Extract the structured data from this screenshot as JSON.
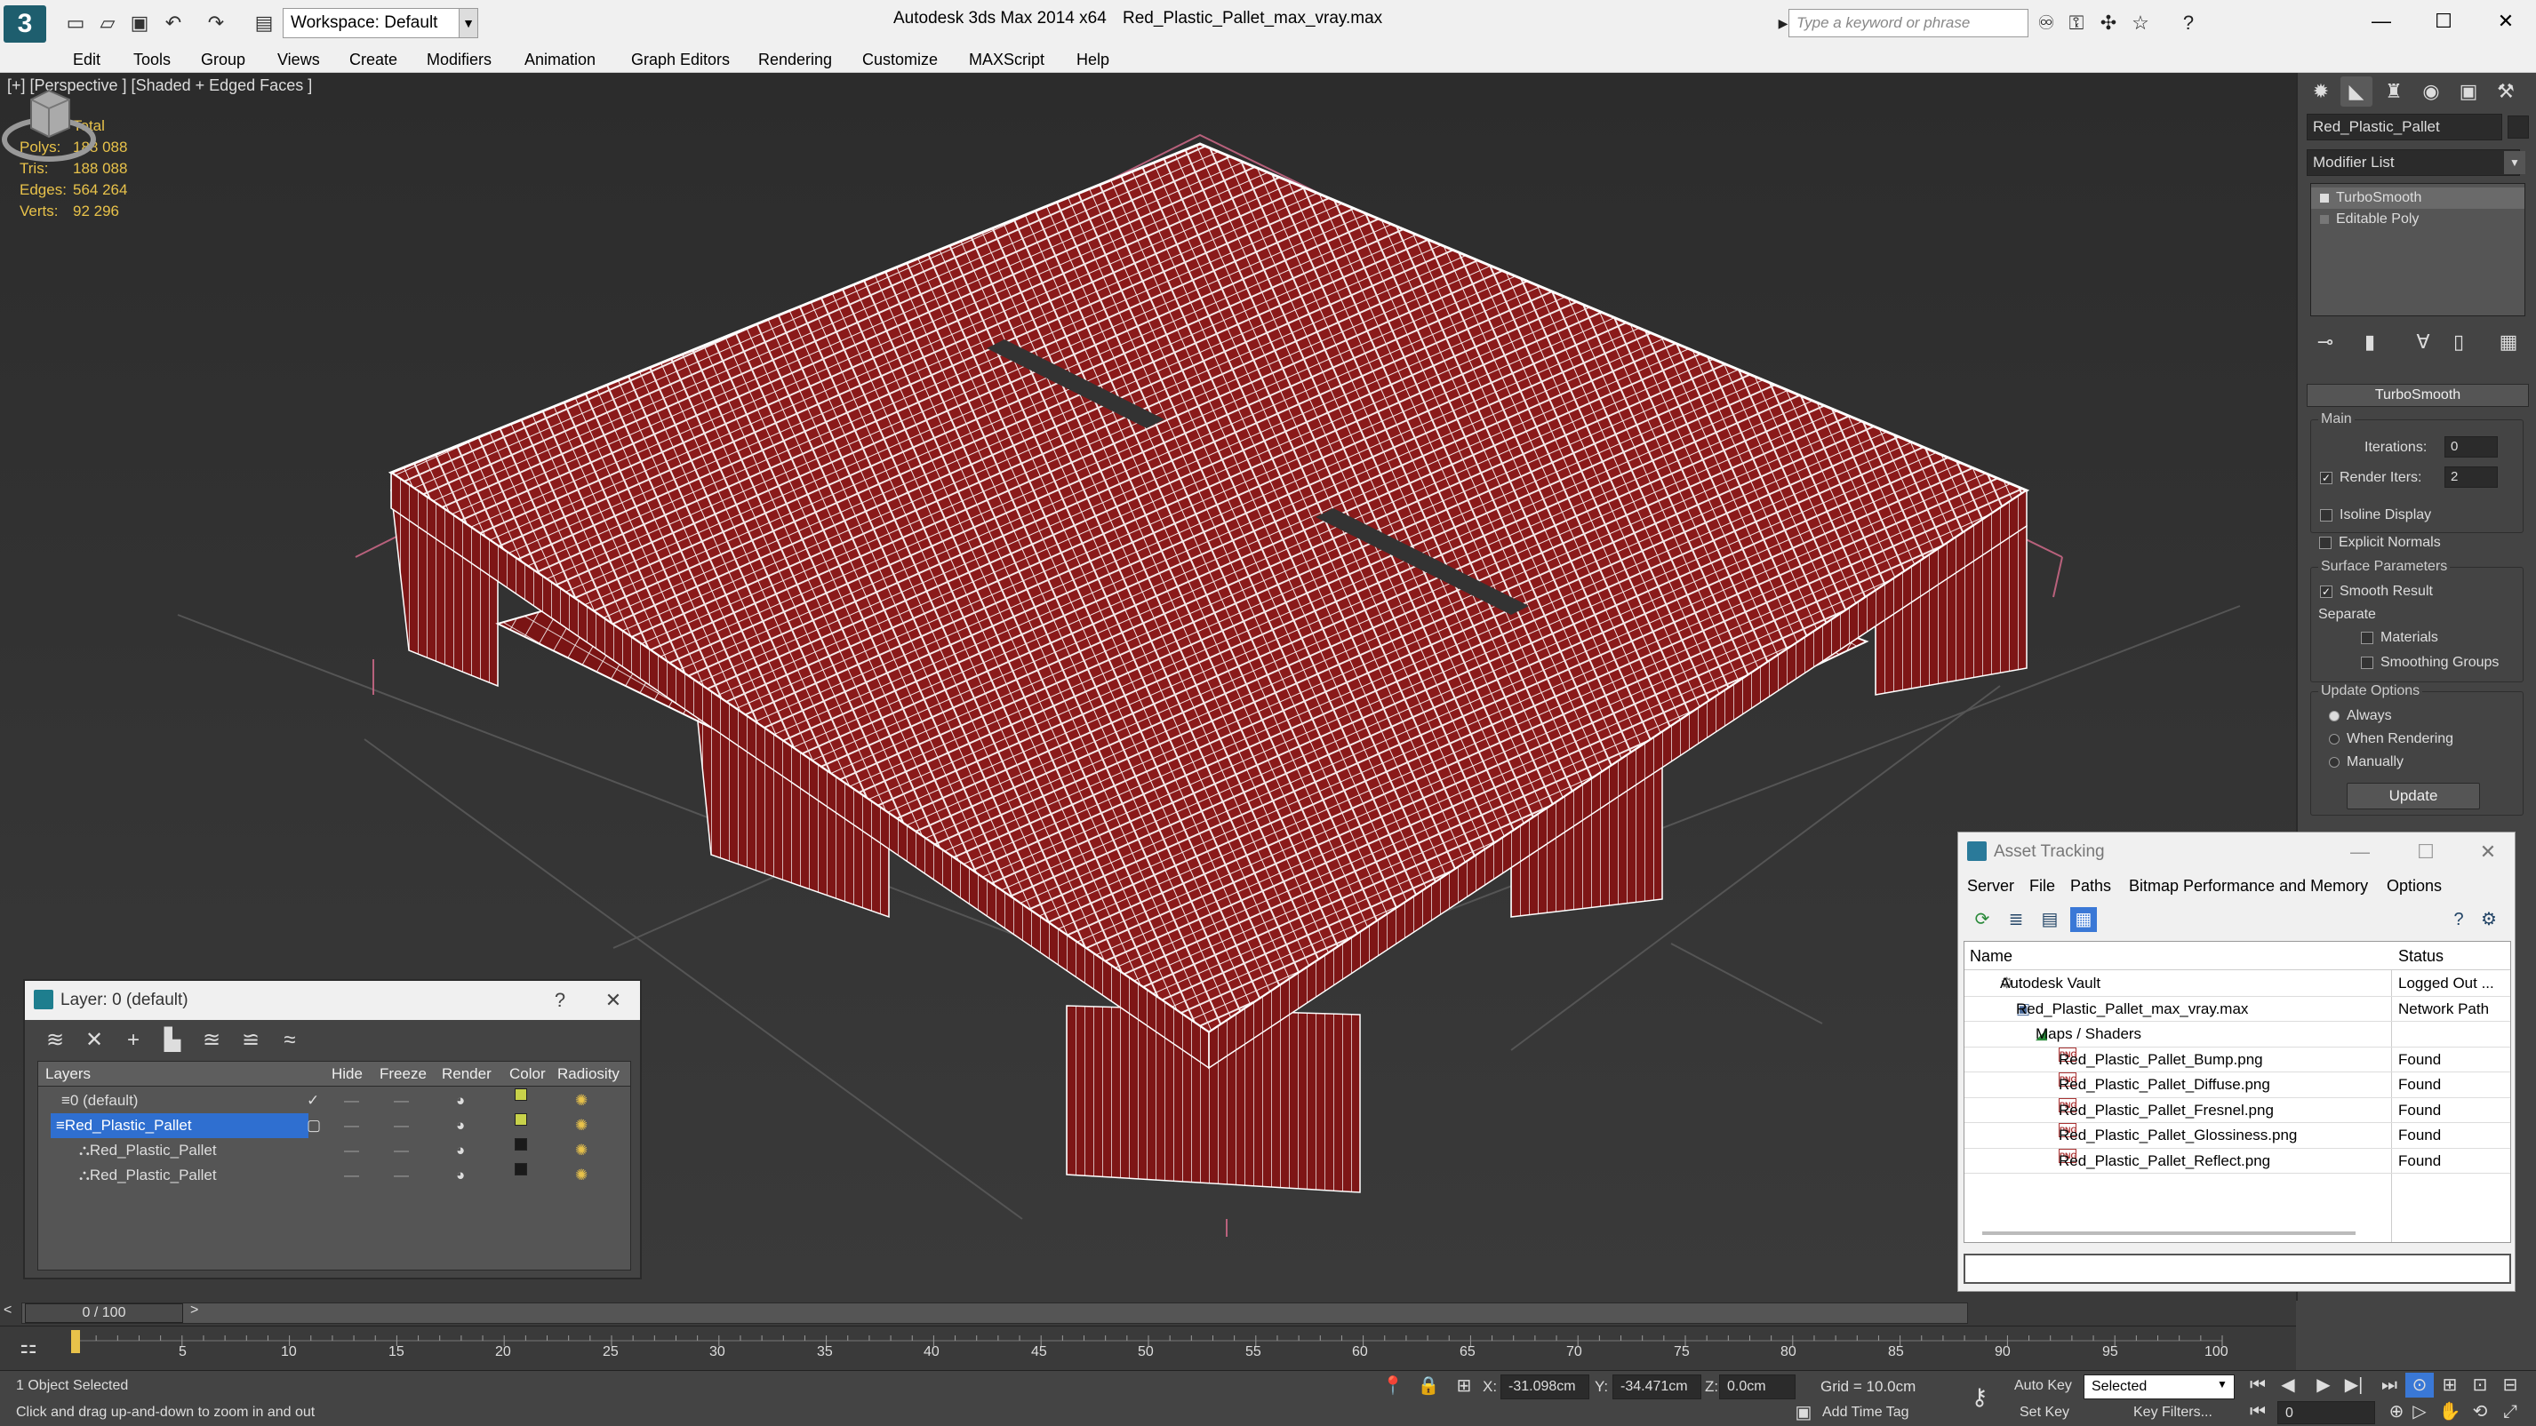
{
  "app": {
    "title": "Autodesk 3ds Max  2014 x64",
    "file": "Red_Plastic_Pallet_max_vray.max",
    "workspace": "Workspace: Default",
    "search_placeholder": "Type a keyword or phrase"
  },
  "menu": [
    "Edit",
    "Tools",
    "Group",
    "Views",
    "Create",
    "Modifiers",
    "Animation",
    "Graph Editors",
    "Rendering",
    "Customize",
    "MAXScript",
    "Help"
  ],
  "viewport": {
    "label": "[+] [Perspective ] [Shaded + Edged Faces ]",
    "stats": {
      "header": "Total",
      "rows": [
        {
          "label": "Polys:",
          "value": "188 088"
        },
        {
          "label": "Tris:",
          "value": "188 088"
        },
        {
          "label": "Edges:",
          "value": "564 264"
        },
        {
          "label": "Verts:",
          "value": "92 296"
        }
      ]
    }
  },
  "command_panel": {
    "object_name": "Red_Plastic_Pallet",
    "modifier_list": "Modifier List",
    "stack": [
      "TurboSmooth",
      "Editable Poly"
    ],
    "rollout_title": "TurboSmooth",
    "main_group": "Main",
    "iterations_label": "Iterations:",
    "iterations_value": "0",
    "render_iters_label": "Render Iters:",
    "render_iters_value": "2",
    "isoline": "Isoline Display",
    "explicit_normals": "Explicit Normals",
    "surface_group": "Surface Parameters",
    "smooth_result": "Smooth Result",
    "separate": "Separate",
    "materials": "Materials",
    "smoothing_groups": "Smoothing Groups",
    "update_group": "Update Options",
    "always": "Always",
    "when_rendering": "When Rendering",
    "manually": "Manually",
    "update_button": "Update"
  },
  "layer_window": {
    "title": "Layer: 0 (default)",
    "help": "?",
    "columns": [
      "Layers",
      "Hide",
      "Freeze",
      "Render",
      "Color",
      "Radiosity"
    ],
    "rows": [
      {
        "name": "0 (default)",
        "color": "#c8d24a"
      },
      {
        "name": "Red_Plastic_Pallet",
        "color": "#c8d24a"
      },
      {
        "name": "Red_Plastic_Pallet",
        "color": "#1a1a1a"
      },
      {
        "name": "Red_Plastic_Pallet",
        "color": "#1a1a1a"
      }
    ]
  },
  "asset_tracking": {
    "title": "Asset Tracking",
    "menu": [
      "Server",
      "File",
      "Paths",
      "Bitmap Performance and Memory",
      "Options"
    ],
    "columns": [
      "Name",
      "Status"
    ],
    "rows": [
      {
        "name": "Autodesk Vault",
        "status": "Logged Out ..."
      },
      {
        "name": "Red_Plastic_Pallet_max_vray.max",
        "status": "Network Path"
      },
      {
        "name": "Maps / Shaders",
        "status": ""
      },
      {
        "name": "Red_Plastic_Pallet_Bump.png",
        "status": "Found"
      },
      {
        "name": "Red_Plastic_Pallet_Diffuse.png",
        "status": "Found"
      },
      {
        "name": "Red_Plastic_Pallet_Fresnel.png",
        "status": "Found"
      },
      {
        "name": "Red_Plastic_Pallet_Glossiness.png",
        "status": "Found"
      },
      {
        "name": "Red_Plastic_Pallet_Reflect.png",
        "status": "Found"
      }
    ],
    "png_badge": "PNG"
  },
  "timeline": {
    "slider": "0 / 100",
    "ticks": [
      "5",
      "10",
      "15",
      "20",
      "25",
      "30",
      "35",
      "40",
      "45",
      "50",
      "55",
      "60",
      "65",
      "70",
      "75",
      "80",
      "85",
      "90",
      "95",
      "100"
    ]
  },
  "status": {
    "selection": "1 Object Selected",
    "prompt": "Click and drag up-and-down to zoom in and out",
    "x_label": "X:",
    "x_value": "-31.098cm",
    "y_label": "Y:",
    "y_value": "-34.471cm",
    "z_label": "Z:",
    "z_value": "0.0cm",
    "grid": "Grid = 10.0cm",
    "auto_key": "Auto Key",
    "selected": "Selected",
    "set_key": "Set Key",
    "key_filters": "Key Filters...",
    "add_time_tag": "Add Time Tag",
    "frame": "0"
  },
  "colors": {
    "mesh_face": "#8a1a1a",
    "mesh_wire": "#ffffff",
    "stats": "#e8c24a",
    "selection": "#2f6fd0"
  }
}
